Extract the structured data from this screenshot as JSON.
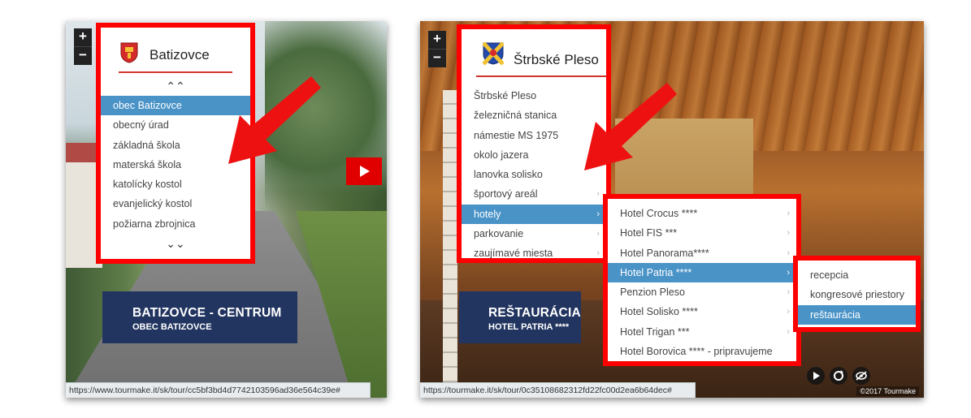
{
  "left": {
    "zoom": {
      "plus": "+",
      "minus": "−"
    },
    "logo_title": "Batizovce",
    "scroll_up": "⌃⌃",
    "items": [
      {
        "label": "obec Batizovce",
        "active": true
      },
      {
        "label": "obecný úrad"
      },
      {
        "label": "základná škola"
      },
      {
        "label": "materská škola"
      },
      {
        "label": "katolícky kostol"
      },
      {
        "label": "evanjelický kostol"
      },
      {
        "label": "požiarna zbrojnica"
      }
    ],
    "scroll_down": "⌄⌄",
    "caption": {
      "title": "BATIZOVCE - CENTRUM",
      "subtitle": "OBEC BATIZOVCE"
    },
    "status_url": "https://www.tourmake.it/sk/tour/cc5bf3bd4d7742103596ad36e564c39e#"
  },
  "right": {
    "zoom": {
      "plus": "+",
      "minus": "−"
    },
    "logo_title": "Štrbské Pleso",
    "items": [
      {
        "label": "Štrbské Pleso"
      },
      {
        "label": "železničná stanica"
      },
      {
        "label": "námestie MS 1975"
      },
      {
        "label": "okolo jazera"
      },
      {
        "label": "lanovka solisko"
      },
      {
        "label": "športový areál",
        "chev": "›"
      },
      {
        "label": "hotely",
        "chev": "›",
        "active": true
      },
      {
        "label": "parkovanie",
        "chev": "›"
      },
      {
        "label": "zaujímavé miesta",
        "chev": "›"
      }
    ],
    "hotels": [
      {
        "label": "Hotel Crocus ****",
        "chev": "›"
      },
      {
        "label": "Hotel FIS ***",
        "chev": "›"
      },
      {
        "label": "Hotel Panorama****",
        "chev": "›"
      },
      {
        "label": "Hotel Patria ****",
        "chev": "›",
        "active": true
      },
      {
        "label": "Penzion Pleso",
        "chev": "›"
      },
      {
        "label": "Hotel Solisko ****",
        "chev": "›"
      },
      {
        "label": "Hotel Trigan ***",
        "chev": "›"
      },
      {
        "label": "Hotel Borovica **** - pripravujeme"
      }
    ],
    "patria_items": [
      {
        "label": "recepcia"
      },
      {
        "label": "kongresové priestory"
      },
      {
        "label": "reštaurácia",
        "active": true
      }
    ],
    "caption": {
      "title": "REŠTAURÁCIA",
      "subtitle": "HOTEL PATRIA ****"
    },
    "status_url": "https://tourmake.it/sk/tour/0c35108682312fd22fc00d2ea6b64dec#",
    "copyright": "©2017 Tourmake"
  },
  "colors": {
    "highlight_border": "#ff0000",
    "active_item": "#4a93c7",
    "caption_bg": "#223560"
  }
}
